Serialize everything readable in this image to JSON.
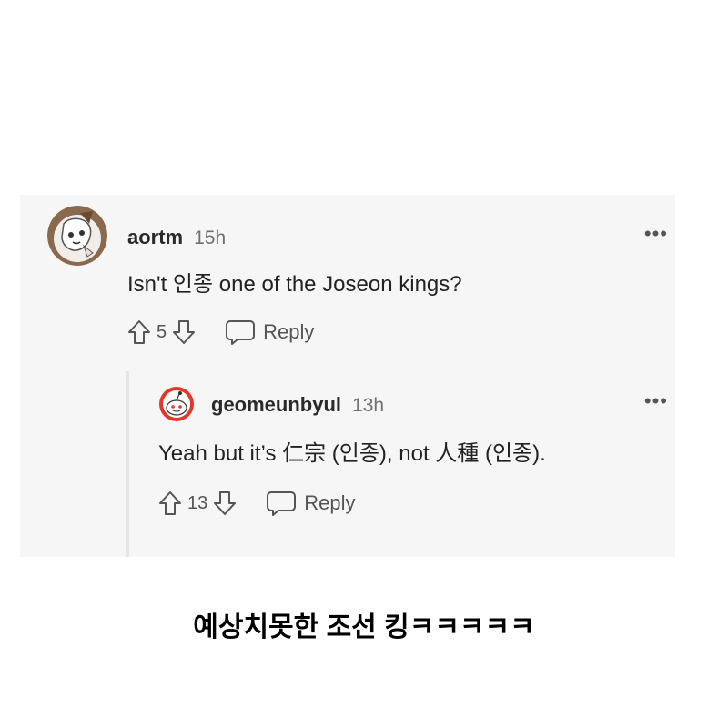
{
  "comments": [
    {
      "username": "aortm",
      "time": "15h",
      "body": "Isn't 인종 one of the Joseon kings?",
      "score": "5",
      "reply_label": "Reply",
      "more_label": "•••",
      "avatar": "fox-avatar-icon"
    },
    {
      "username": "geomeunbyul",
      "time": "13h",
      "body": "Yeah but it’s 仁宗 (인종), not 人種 (인종).",
      "score": "13",
      "reply_label": "Reply",
      "more_label": "•••",
      "avatar": "snoo-avatar-icon"
    }
  ],
  "caption": "예상치못한 조선 킹ㅋㅋㅋㅋㅋ",
  "colors": {
    "panel_bg": "#f6f6f6",
    "avatar1_bg": "#8a6a4f",
    "avatar2_accent": "#e0382c",
    "muted_text": "#6f6f6f"
  }
}
